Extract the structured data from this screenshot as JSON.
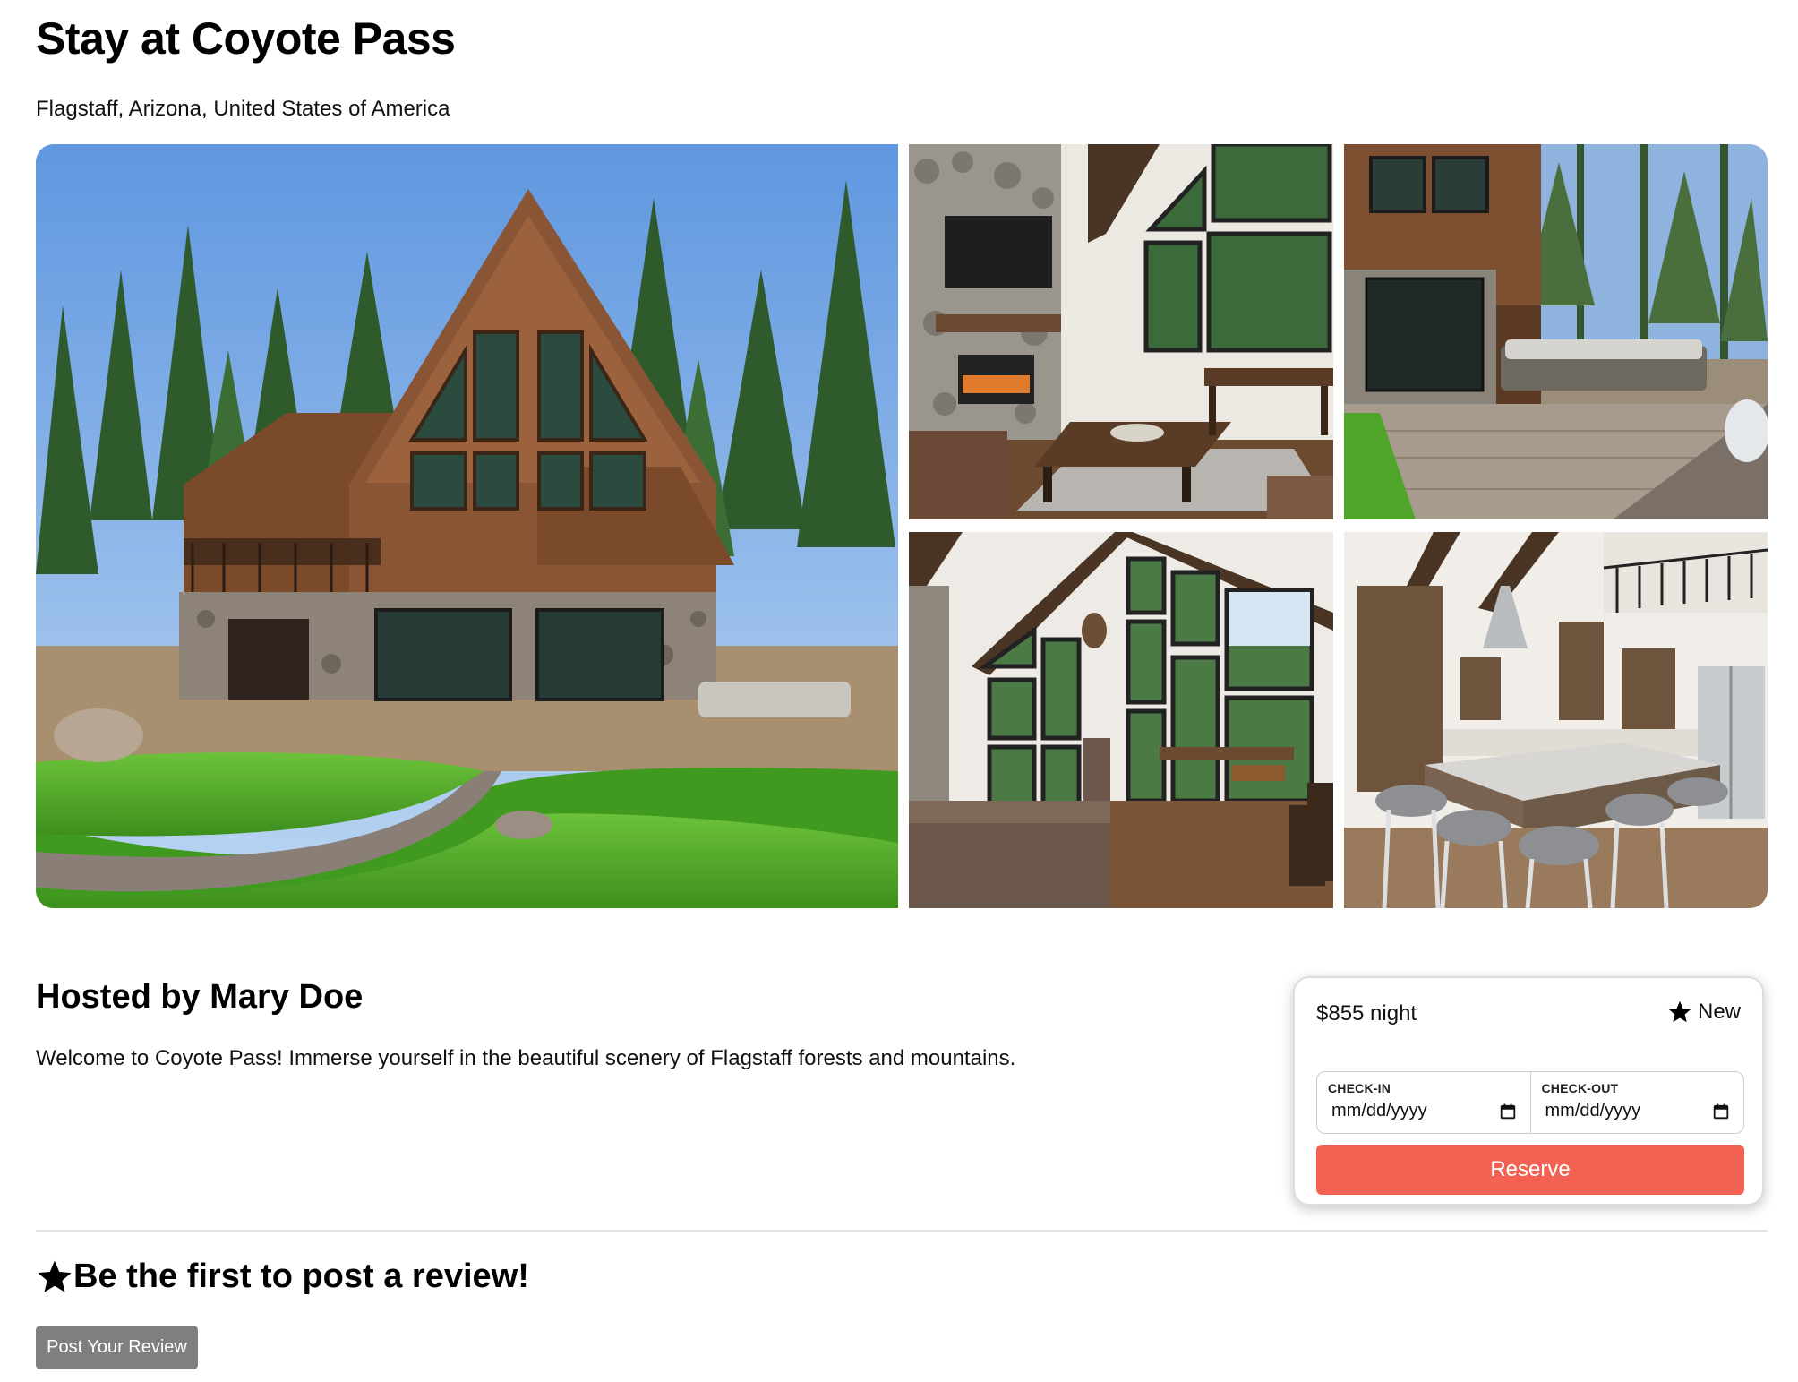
{
  "listing": {
    "title": "Stay at Coyote Pass",
    "location": "Flagstaff, Arizona, United States of America"
  },
  "gallery": {
    "photos": [
      {
        "subject": "cabin-exterior"
      },
      {
        "subject": "living-room-fireplace"
      },
      {
        "subject": "stone-patio"
      },
      {
        "subject": "great-room-windows"
      },
      {
        "subject": "kitchen-island"
      }
    ]
  },
  "host": {
    "heading": "Hosted by Mary Doe",
    "description": "Welcome to Coyote Pass! Immerse yourself in the beautiful scenery of Flagstaff forests and mountains."
  },
  "booking": {
    "price": "$855 night",
    "rating_label": "New",
    "check_in_label": "CHECK-IN",
    "check_out_label": "CHECK-OUT",
    "check_in_value": "mm/dd/yyyy",
    "check_out_value": "mm/dd/yyyy",
    "reserve_label": "Reserve",
    "accent_color": "#f26152"
  },
  "reviews": {
    "heading": "Be the first to post a review!",
    "post_button_label": "Post Your Review"
  },
  "icons": {
    "rating": "star-icon",
    "review": "star-icon",
    "date_picker": "calendar-icon"
  }
}
